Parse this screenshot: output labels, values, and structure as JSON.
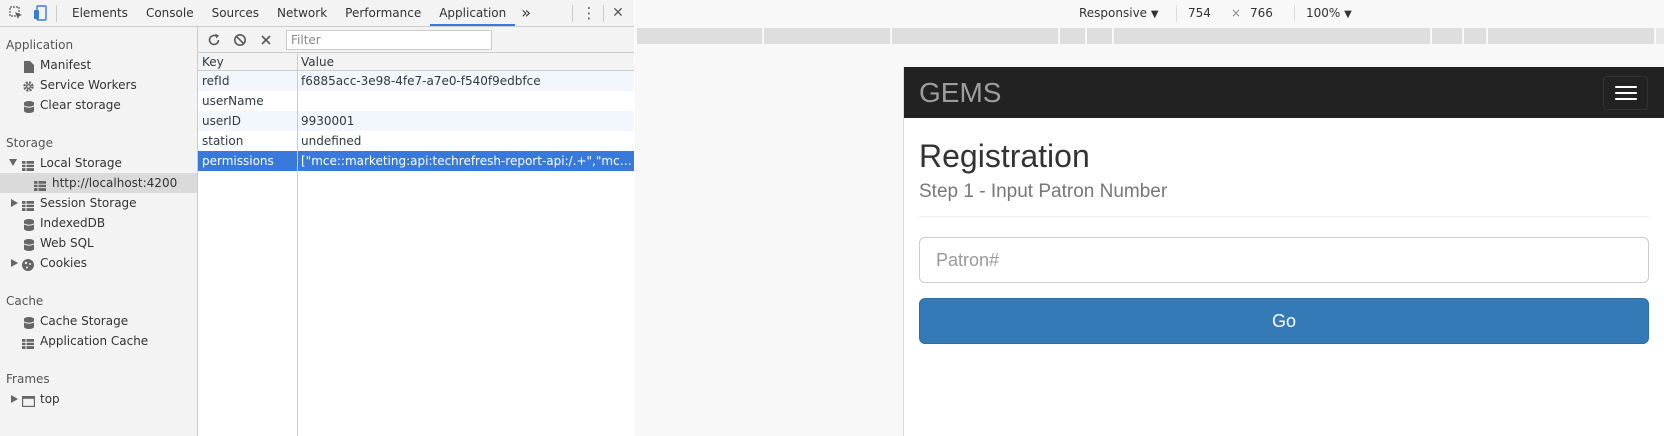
{
  "devtools": {
    "tabs": [
      "Elements",
      "Console",
      "Sources",
      "Network",
      "Performance",
      "Application"
    ],
    "active_tab": "Application",
    "more_glyph": "»",
    "menu_glyph": "⋮",
    "close_glyph": "✕"
  },
  "sidebar": {
    "application": {
      "header": "Application",
      "items": [
        {
          "label": "Manifest",
          "icon": "document-icon"
        },
        {
          "label": "Service Workers",
          "icon": "gear-icon"
        },
        {
          "label": "Clear storage",
          "icon": "database-icon"
        }
      ]
    },
    "storage": {
      "header": "Storage",
      "local_storage": "Local Storage",
      "local_origin": "http://localhost:4200",
      "session_storage": "Session Storage",
      "indexeddb": "IndexedDB",
      "websql": "Web SQL",
      "cookies": "Cookies"
    },
    "cache": {
      "header": "Cache",
      "cache_storage": "Cache Storage",
      "application_cache": "Application Cache"
    },
    "frames": {
      "header": "Frames",
      "top": "top"
    }
  },
  "storage_view": {
    "filter_placeholder": "Filter",
    "columns": {
      "key": "Key",
      "value": "Value"
    },
    "rows": [
      {
        "key": "refId",
        "value": "f6885acc-3e98-4fe7-a7e0-f540f9edbfce"
      },
      {
        "key": "userName",
        "value": ""
      },
      {
        "key": "userID",
        "value": "9930001"
      },
      {
        "key": "station",
        "value": "undefined"
      },
      {
        "key": "permissions",
        "value": "[\"mce::marketing:api:techrefresh-report-api:/.+\",\"mce::ma..."
      }
    ],
    "selected_row": 4
  },
  "device_toolbar": {
    "device": "Responsive",
    "width": "754",
    "times": "×",
    "height": "766",
    "zoom": "100%"
  },
  "app": {
    "brand": "GEMS",
    "title": "Registration",
    "subtitle": "Step 1 - Input Patron Number",
    "patron_placeholder": "Patron#",
    "go_label": "Go"
  },
  "colors": {
    "accent": "#3879d9",
    "navbar": "#222222",
    "primary_button": "#337ab7"
  }
}
